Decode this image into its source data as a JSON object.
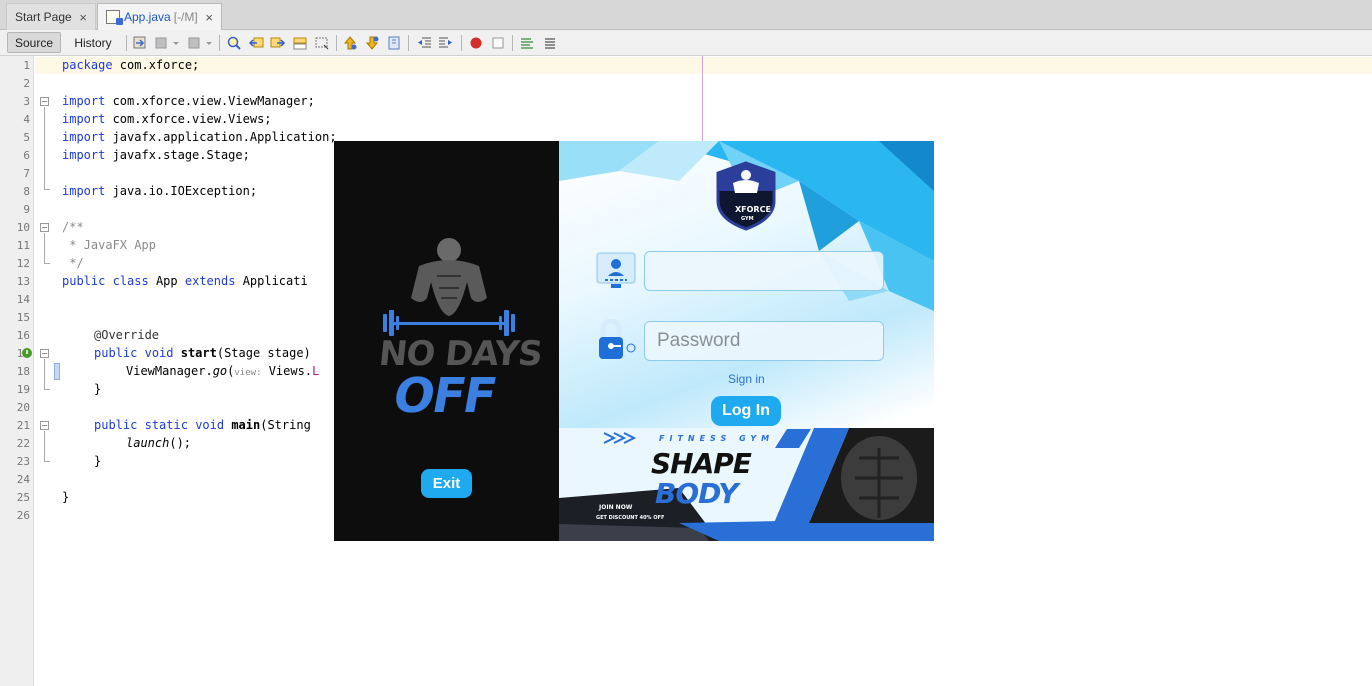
{
  "tabs": [
    {
      "label": "Start Page",
      "suffix": "",
      "close": "×"
    },
    {
      "label": "App.java",
      "suffix": "[-/M]",
      "close": "×"
    }
  ],
  "toolbar": {
    "source_label": "Source",
    "history_label": "History"
  },
  "editor": {
    "line_numbers": [
      "1",
      "2",
      "3",
      "4",
      "5",
      "6",
      "7",
      "8",
      "9",
      "10",
      "11",
      "12",
      "13",
      "14",
      "15",
      "16",
      "17",
      "18",
      "19",
      "20",
      "21",
      "22",
      "23",
      "24",
      "25",
      "26"
    ],
    "code": {
      "l1_kw": "package",
      "l1_rest": " com.xforce;",
      "l3_kw": "import",
      "l3_rest": " com.xforce.view.ViewManager;",
      "l4_kw": "import",
      "l4_rest": " com.xforce.view.Views;",
      "l5_kw": "import",
      "l5_rest": " javafx.application.Application;",
      "l6_kw": "import",
      "l6_rest": " javafx.stage.Stage;",
      "l8_kw": "import",
      "l8_rest": " java.io.IOException;",
      "l10": "/**",
      "l11": " * JavaFX App",
      "l12": " */",
      "l13_kw1": "public",
      "l13_kw2": "class",
      "l13_name": "App",
      "l13_kw3": "extends",
      "l13_rest": "Applicati",
      "l16": "@Override",
      "l17_kw1": "public",
      "l17_kw2": "void",
      "l17_fn": "start",
      "l17_rest": "(Stage stage)",
      "l18_pre": "ViewManager.",
      "l18_it": "go",
      "l18_paren": "(",
      "l18_hint": "view:",
      "l18_rest": " Views.",
      "l18_tail": "L",
      "l19": "}",
      "l21_kw1": "public",
      "l21_kw2": "static",
      "l21_kw3": "void",
      "l21_fn": "main",
      "l21_rest": "(String",
      "l22_it": "launch",
      "l22_rest": "();",
      "l23": "}",
      "l25": "}"
    }
  },
  "app": {
    "left": {
      "slogan_top": "NO DAYS",
      "slogan_bottom": "OFF",
      "exit_label": "Exit"
    },
    "logo": {
      "line1": "XFORCE",
      "line2": "GYM"
    },
    "username": {
      "value": "",
      "placeholder": ""
    },
    "password": {
      "value": "",
      "placeholder": "Password"
    },
    "signin_label": "Sign in",
    "login_label": "Log In",
    "promo": {
      "tag": "FITNESS GYM",
      "title1": "SHAPE",
      "title2": "BODY",
      "join": "JOIN NOW",
      "discount": "GET DISCOUNT 40% OFF"
    }
  },
  "colors": {
    "accent_button": "#1faaf0",
    "keyword": "#1d3bd6",
    "comment": "#8a8a8a",
    "dark_pane": "#0d0d0d"
  }
}
